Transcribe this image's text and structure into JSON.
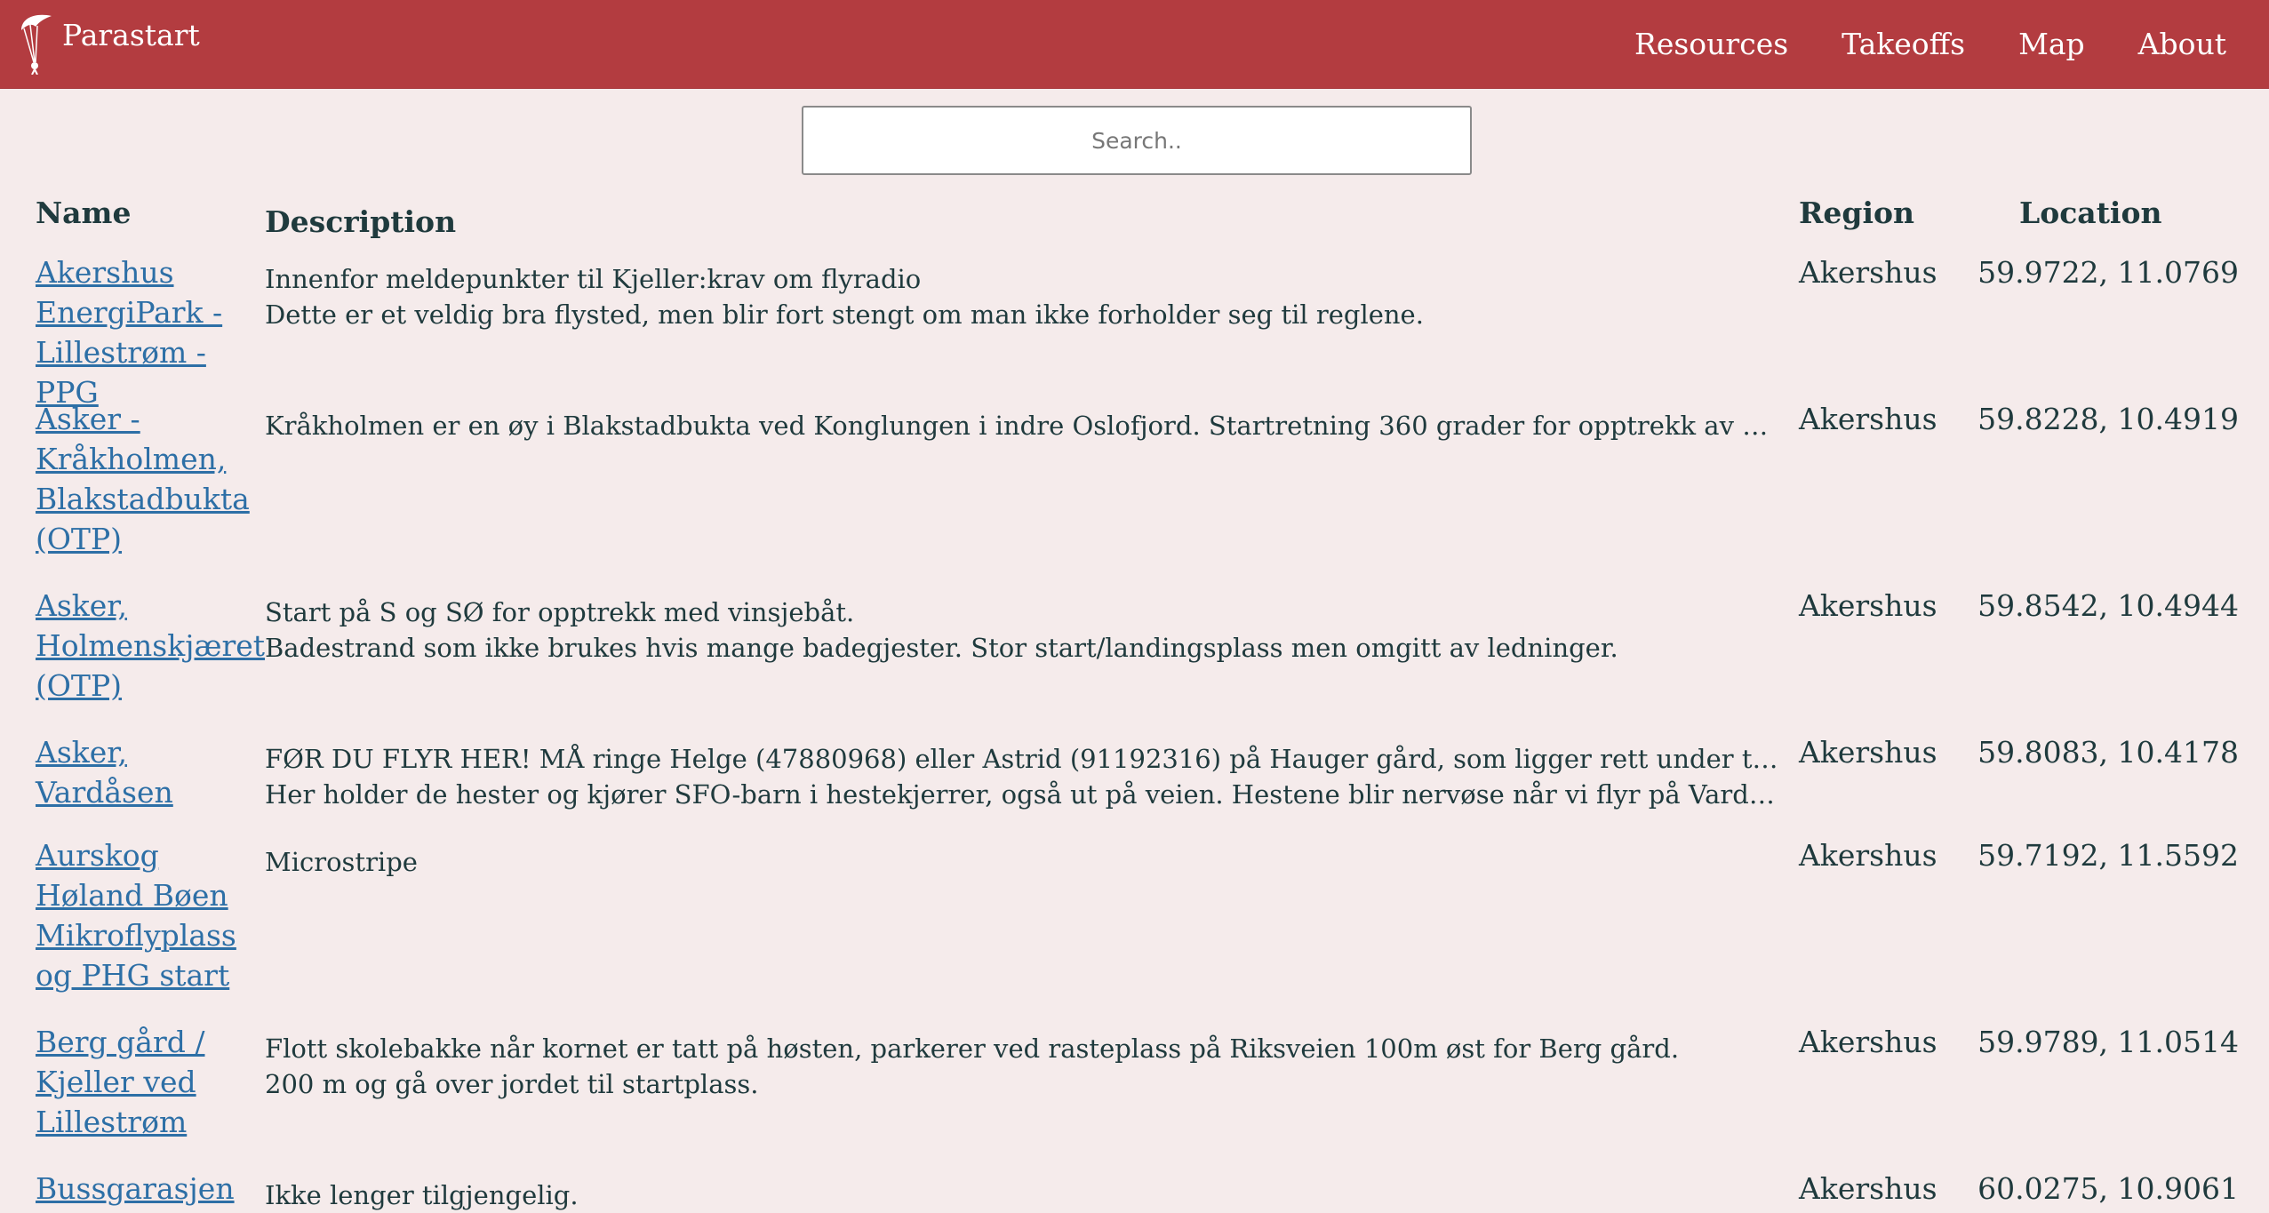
{
  "brand": {
    "name": "Parastart",
    "icon": "paraglider-icon"
  },
  "nav": [
    "Resources",
    "Takeoffs",
    "Map",
    "About"
  ],
  "search": {
    "placeholder": "Search..",
    "value": ""
  },
  "table": {
    "headers": {
      "name": "Name",
      "description": "Description",
      "region": "Region",
      "location": "Location"
    },
    "rows": [
      {
        "name": "Akershus EnergiPark - Lillestrøm - PPG",
        "description": [
          "Innenfor meldepunkter til Kjeller:krav om flyradio",
          "Dette er et veldig bra flysted, men blir fort stengt om man ikke forholder seg til reglene."
        ],
        "region": "Akershus",
        "location": "59.9722, 11.0769"
      },
      {
        "name": "Asker - Kråkholmen, Blakstadbukta (OTP)",
        "description": [
          "Kråkholmen er en øy i Blakstadbukta ved Konglungen i indre Oslofjord. Startretning 360 grader for opptrekk av solo, Acro ..."
        ],
        "region": "Akershus",
        "location": "59.8228, 10.4919"
      },
      {
        "name": "Asker, Holmenskjæret (OTP)",
        "description": [
          "Start på S og SØ for opptrekk med vinsjebåt.",
          "Badestrand som ikke brukes hvis mange badegjester. Stor start/landingsplass men omgitt av ledninger."
        ],
        "region": "Akershus",
        "location": "59.8542, 10.4944"
      },
      {
        "name": "Asker, Vardåsen",
        "description": [
          "FØR DU FLYR HER! MÅ ringe Helge (47880968) eller Astrid (91192316) på Hauger gård, som ligger rett under take-off.",
          "Her holder de hester og kjører SFO-barn i hestekjerrer, også ut på veien. Hestene blir nervøse når vi flyr på Vardåsen og ka..."
        ],
        "region": "Akershus",
        "location": "59.8083, 10.4178"
      },
      {
        "name": "Aurskog Høland Bøen Mikroflyplass og PHG start",
        "description": [
          "Microstripe"
        ],
        "region": "Akershus",
        "location": "59.7192, 11.5592"
      },
      {
        "name": "Berg gård / Kjeller ved Lillestrøm",
        "description": [
          "Flott skolebakke når kornet er tatt på høsten, parkerer ved rasteplass på Riksveien 100m øst for Berg gård.",
          "200 m og gå over jordet til startplass."
        ],
        "region": "Akershus",
        "location": "59.9789, 11.0514"
      },
      {
        "name": "Bussgarasjen",
        "description": [
          "Ikke lenger tilgjengelig."
        ],
        "region": "Akershus",
        "location": "60.0275, 10.9061"
      }
    ]
  }
}
